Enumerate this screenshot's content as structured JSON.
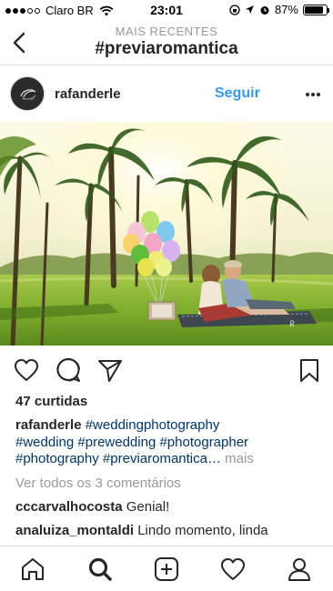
{
  "status_bar": {
    "carrier": "Claro BR",
    "time": "23:01",
    "battery_percent": "87%",
    "battery_level": 0.87,
    "signal_bars": 3
  },
  "header": {
    "subtitle": "MAIS RECENTES",
    "title": "#previaromantica"
  },
  "post": {
    "username": "rafanderle",
    "follow_label": "Seguir",
    "likes": "47 curtidas",
    "caption": {
      "user": "rafanderle",
      "tags": [
        "#weddingphotography",
        "#wedding",
        "#prewedding",
        "#photographer",
        "#photography",
        "#previaromantica…"
      ],
      "more": "mais"
    },
    "view_all_comments": "Ver todos os 3 comentários",
    "comments": [
      {
        "user": "cccarvalhocosta",
        "text": "Genial!"
      },
      {
        "user": "analuiza_montaldi",
        "text": "Lindo momento, linda"
      }
    ]
  },
  "icons": {
    "back": "chevron-left-icon",
    "more": "more-horizontal-icon",
    "like": "heart-icon",
    "comment": "comment-icon",
    "share": "send-icon",
    "save": "bookmark-icon"
  },
  "nav": [
    "home-icon",
    "search-icon",
    "add-icon",
    "activity-icon",
    "profile-icon"
  ],
  "colors": {
    "accent": "#3897f0",
    "hashtag": "#003569",
    "muted": "#999999"
  }
}
